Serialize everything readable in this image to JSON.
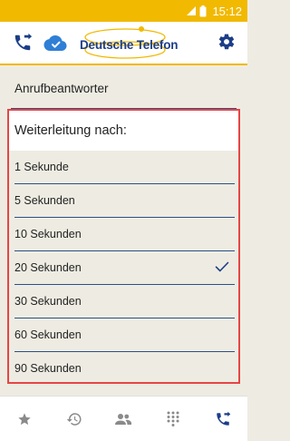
{
  "status_bar": {
    "time": "15:12"
  },
  "app_bar": {
    "logo_text": "Deutsche Telefon",
    "left_icons": [
      "call-forward-icon",
      "cloud-check-icon"
    ],
    "right_icon": "gear-icon"
  },
  "section": {
    "title": "Anrufbeantworter"
  },
  "dialog": {
    "title": "Weiterleitung nach:",
    "options": [
      {
        "label": "1 Sekunde"
      },
      {
        "label": "5 Sekunden"
      },
      {
        "label": "10 Sekunden"
      },
      {
        "label": "20 Sekunden"
      },
      {
        "label": "30 Sekunden"
      },
      {
        "label": "60 Sekunden"
      },
      {
        "label": "90 Sekunden"
      }
    ],
    "selected_index": 3
  },
  "bottom_nav": {
    "items": [
      "star-icon",
      "history-icon",
      "contacts-icon",
      "dialpad-icon",
      "call-forward-icon"
    ],
    "active_index": 4
  },
  "colors": {
    "accent_yellow": "#f1b900",
    "brand_blue": "#1c3e87",
    "highlight_red": "#e64545",
    "background": "#eeece2"
  }
}
